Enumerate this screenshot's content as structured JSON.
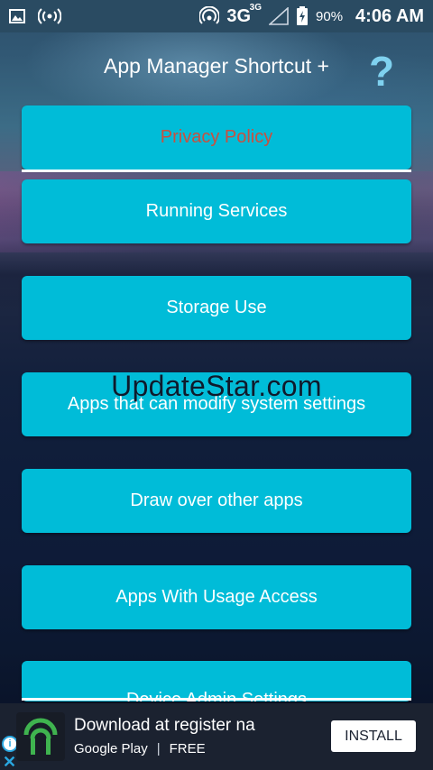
{
  "status_bar": {
    "network_type": "3G",
    "network_sup": "3G",
    "battery_percent": "90%",
    "time": "4:06 AM",
    "icons": [
      "gallery-icon",
      "hotspot-icon",
      "wifi-signal-icon",
      "signal-icon",
      "battery-charging-icon"
    ]
  },
  "header": {
    "title": "App Manager Shortcut +",
    "help_icon": "help-icon",
    "help_glyph": "?"
  },
  "menu": {
    "items": [
      {
        "label": "Privacy Policy"
      },
      {
        "label": "Running Services"
      },
      {
        "label": "Storage Use"
      },
      {
        "label": "Apps that can modify system settings"
      },
      {
        "label": "Draw over other apps"
      },
      {
        "label": "Apps With Usage Access"
      },
      {
        "label": "Device Admin Settings"
      }
    ],
    "colors": {
      "button": "#00bcd8",
      "policy_text": "#c9503f"
    }
  },
  "watermark": "UpdateStar.com",
  "ad": {
    "title": "Download at register na",
    "store": "Google Play",
    "separator": "|",
    "price": "FREE",
    "install_label": "INSTALL",
    "info_glyph": "i",
    "close_glyph": "✕"
  }
}
